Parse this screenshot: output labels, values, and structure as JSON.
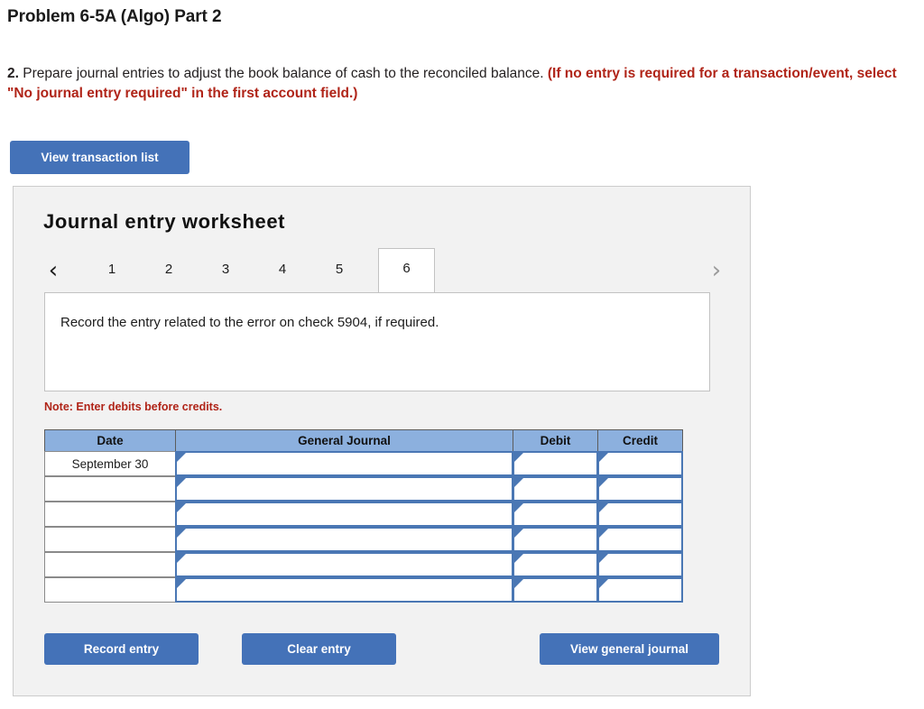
{
  "problem": {
    "title": "Problem 6-5A (Algo) Part 2"
  },
  "prompt": {
    "number": "2.",
    "text": " Prepare journal entries to adjust the book balance of cash to the reconciled balance. ",
    "red_text": "(If no entry is required for a transaction/event, select \"No journal entry required\" in the first account field.)"
  },
  "toolbar": {
    "view_transaction_list": "View transaction list"
  },
  "worksheet": {
    "title": "Journal entry worksheet",
    "prev_arrow": "‹",
    "next_arrow": "›",
    "tabs": [
      {
        "label": "1",
        "active": false
      },
      {
        "label": "2",
        "active": false
      },
      {
        "label": "3",
        "active": false
      },
      {
        "label": "4",
        "active": false
      },
      {
        "label": "5",
        "active": false
      },
      {
        "label": "6",
        "active": true
      }
    ],
    "instruction": "Record the entry related to the error on check 5904, if required.",
    "note": "Note: Enter debits before credits."
  },
  "journal": {
    "columns": [
      "Date",
      "General Journal",
      "Debit",
      "Credit"
    ],
    "rows": [
      {
        "date": "September 30",
        "general_journal": "",
        "debit": "",
        "credit": ""
      },
      {
        "date": "",
        "general_journal": "",
        "debit": "",
        "credit": ""
      },
      {
        "date": "",
        "general_journal": "",
        "debit": "",
        "credit": ""
      },
      {
        "date": "",
        "general_journal": "",
        "debit": "",
        "credit": ""
      },
      {
        "date": "",
        "general_journal": "",
        "debit": "",
        "credit": ""
      },
      {
        "date": "",
        "general_journal": "",
        "debit": "",
        "credit": ""
      }
    ]
  },
  "actions": {
    "record_entry": "Record entry",
    "clear_entry": "Clear entry",
    "view_general_journal": "View general journal"
  },
  "colors": {
    "button_blue": "#4472b8",
    "header_blue": "#8cb0de",
    "input_border_blue": "#4a77b4",
    "red_text": "#b02418",
    "panel_bg": "#f2f2f2"
  }
}
